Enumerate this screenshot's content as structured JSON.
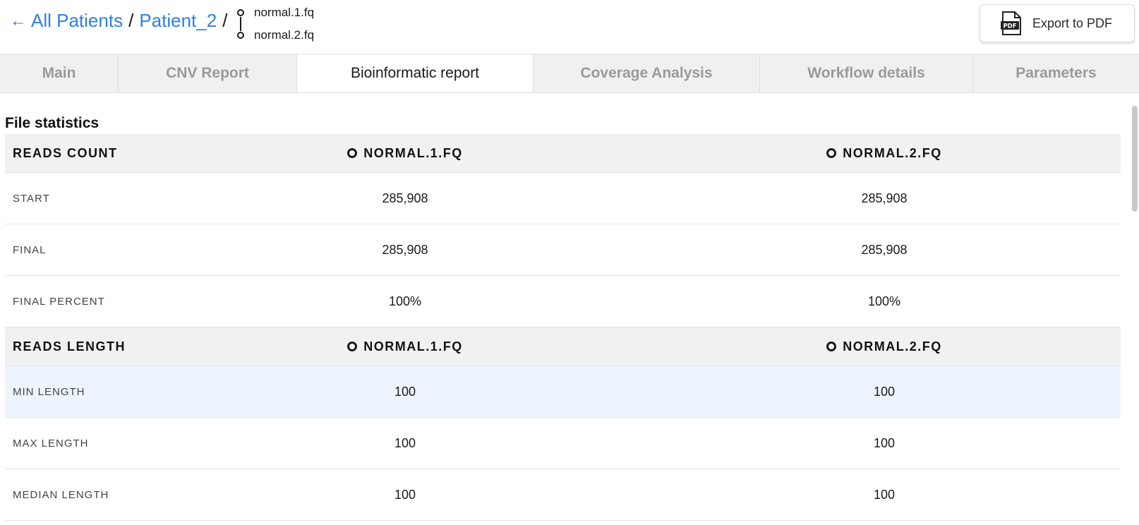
{
  "breadcrumb": {
    "back_arrow": "←",
    "all_patients": "All Patients",
    "separator": "/",
    "patient": "Patient_2",
    "files": [
      "normal.1.fq",
      "normal.2.fq"
    ]
  },
  "export": {
    "label": "Export to PDF",
    "icon": "pdf-file-icon"
  },
  "tabs": [
    {
      "label": "Main",
      "active": false
    },
    {
      "label": "CNV Report",
      "active": false
    },
    {
      "label": "Bioinformatic report",
      "active": true
    },
    {
      "label": "Coverage Analysis",
      "active": false
    },
    {
      "label": "Workflow details",
      "active": false
    },
    {
      "label": "Parameters",
      "active": false
    }
  ],
  "section": {
    "title": "File statistics"
  },
  "table": {
    "groups": [
      {
        "header": "READS COUNT",
        "columns": [
          "NORMAL.1.FQ",
          "NORMAL.2.FQ"
        ],
        "rows": [
          {
            "label": "START",
            "values": [
              "285,908",
              "285,908"
            ]
          },
          {
            "label": "FINAL",
            "values": [
              "285,908",
              "285,908"
            ]
          },
          {
            "label": "FINAL PERCENT",
            "values": [
              "100%",
              "100%"
            ]
          }
        ]
      },
      {
        "header": "READS LENGTH",
        "columns": [
          "NORMAL.1.FQ",
          "NORMAL.2.FQ"
        ],
        "rows": [
          {
            "label": "MIN LENGTH",
            "values": [
              "100",
              "100"
            ]
          },
          {
            "label": "MAX LENGTH",
            "values": [
              "100",
              "100"
            ]
          },
          {
            "label": "MEDIAN LENGTH",
            "values": [
              "100",
              "100"
            ]
          }
        ]
      }
    ]
  },
  "colors": {
    "link": "#2f7fe0",
    "tab_bg": "#f0f0f0",
    "header_bg": "#f1f1f1",
    "highlight_row": "#edf4fe"
  }
}
